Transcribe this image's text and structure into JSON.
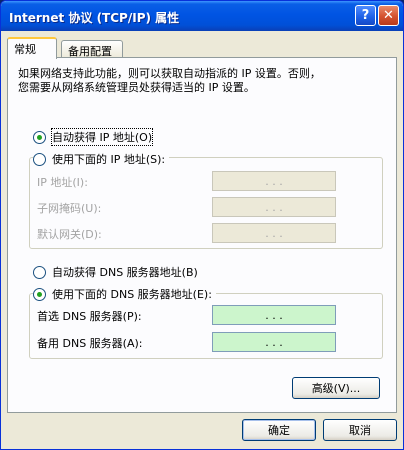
{
  "window": {
    "title": "Internet 协议 (TCP/IP) 属性",
    "help_button": "?",
    "close_button": "✕"
  },
  "tabs": [
    {
      "label": "常规",
      "active": true
    },
    {
      "label": "备用配置",
      "active": false
    }
  ],
  "description": "如果网络支持此功能，则可以获取自动指派的 IP 设置。否则，\n您需要从网络系统管理员处获得适当的 IP 设置。",
  "ip_options": {
    "auto_label": "自动获得 IP 地址(O)",
    "auto_checked": true,
    "manual_label": "使用下面的 IP 地址(S):",
    "manual_checked": false
  },
  "ip_fields": [
    {
      "label": "IP 地址(I):",
      "value": ". . ."
    },
    {
      "label": "子网掩码(U):",
      "value": ". . ."
    },
    {
      "label": "默认网关(D):",
      "value": ". . ."
    }
  ],
  "dns_options": {
    "auto_label": "自动获得 DNS 服务器地址(B)",
    "auto_checked": false,
    "manual_label": "使用下面的 DNS 服务器地址(E):",
    "manual_checked": true
  },
  "dns_fields": [
    {
      "label": "首选 DNS 服务器(P):",
      "value": ". . ."
    },
    {
      "label": "备用 DNS 服务器(A):",
      "value": ". . ."
    }
  ],
  "buttons": {
    "advanced": "高级(V)...",
    "ok": "确定",
    "cancel": "取消"
  },
  "colors": {
    "titlebar": "#0054e3",
    "dialog_bg": "#ece9d8",
    "active_field": "#ccf5cc",
    "radio_dot": "#21a121"
  }
}
